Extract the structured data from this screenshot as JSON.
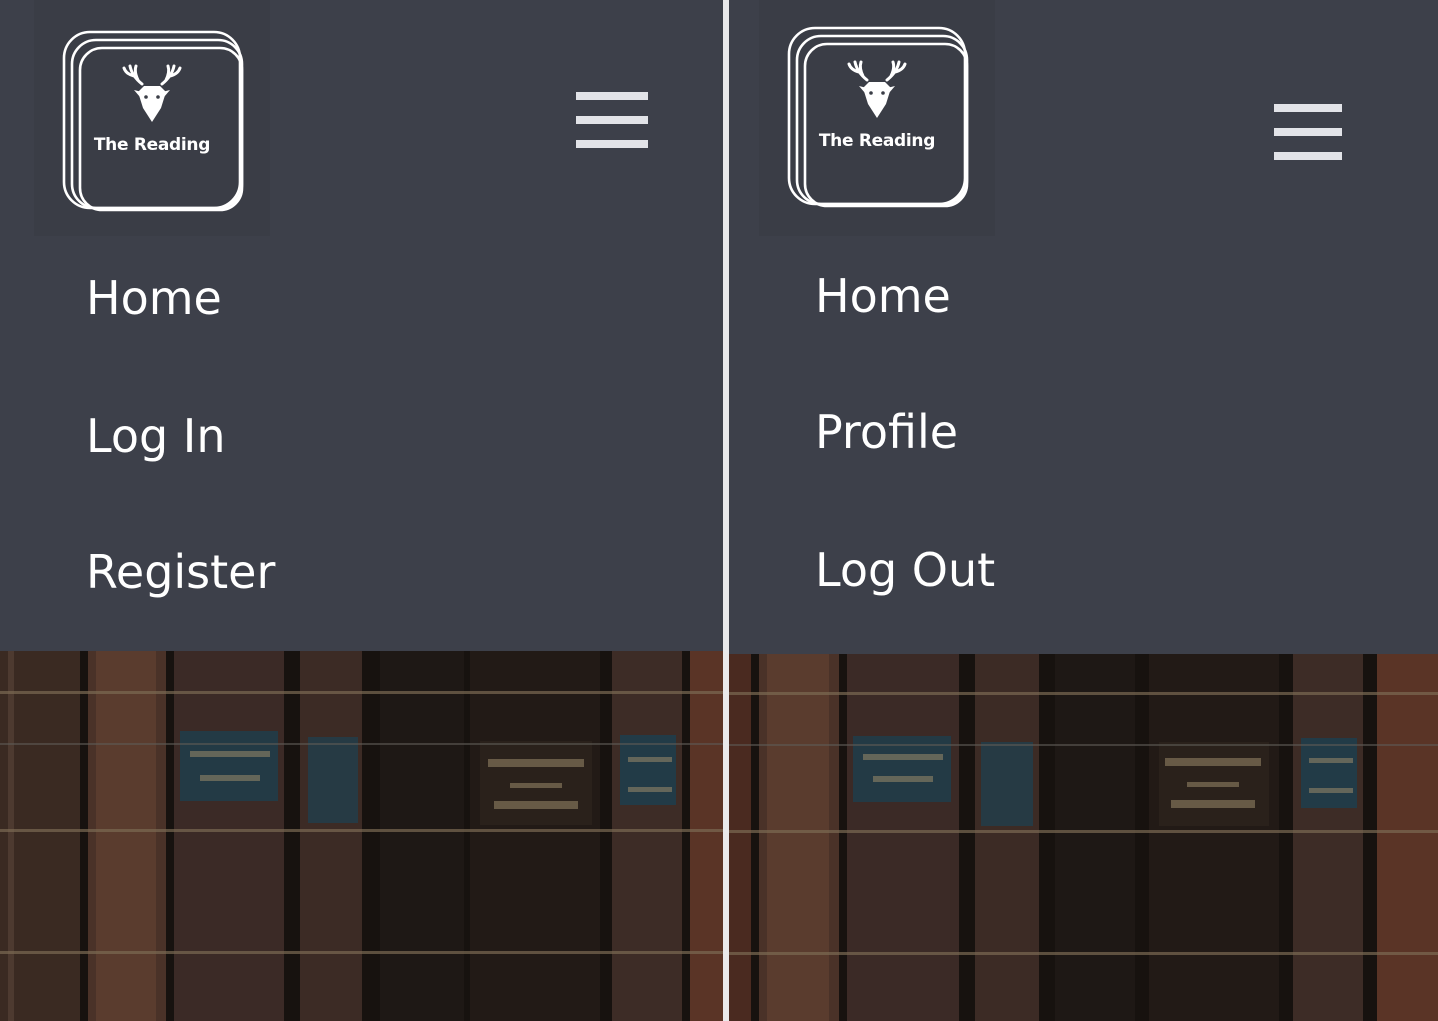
{
  "screens": [
    {
      "logo": {
        "text": "The Reading",
        "icon": "deer-head-icon"
      },
      "menu_icon": "hamburger-menu-icon",
      "menu": [
        "Home",
        "Log In",
        "Register"
      ],
      "hero_image": "books-background"
    },
    {
      "logo": {
        "text": "The Reading",
        "icon": "deer-head-icon"
      },
      "menu_icon": "hamburger-menu-icon",
      "menu": [
        "Home",
        "Profile",
        "Log Out"
      ],
      "hero_image": "books-background"
    }
  ],
  "colors": {
    "navbar_background": "#3d404a",
    "logo_background": "#3a3d46",
    "menu_text": "#ffffff",
    "hamburger": "#e2e3e8",
    "divider": "#e9e9eb"
  }
}
